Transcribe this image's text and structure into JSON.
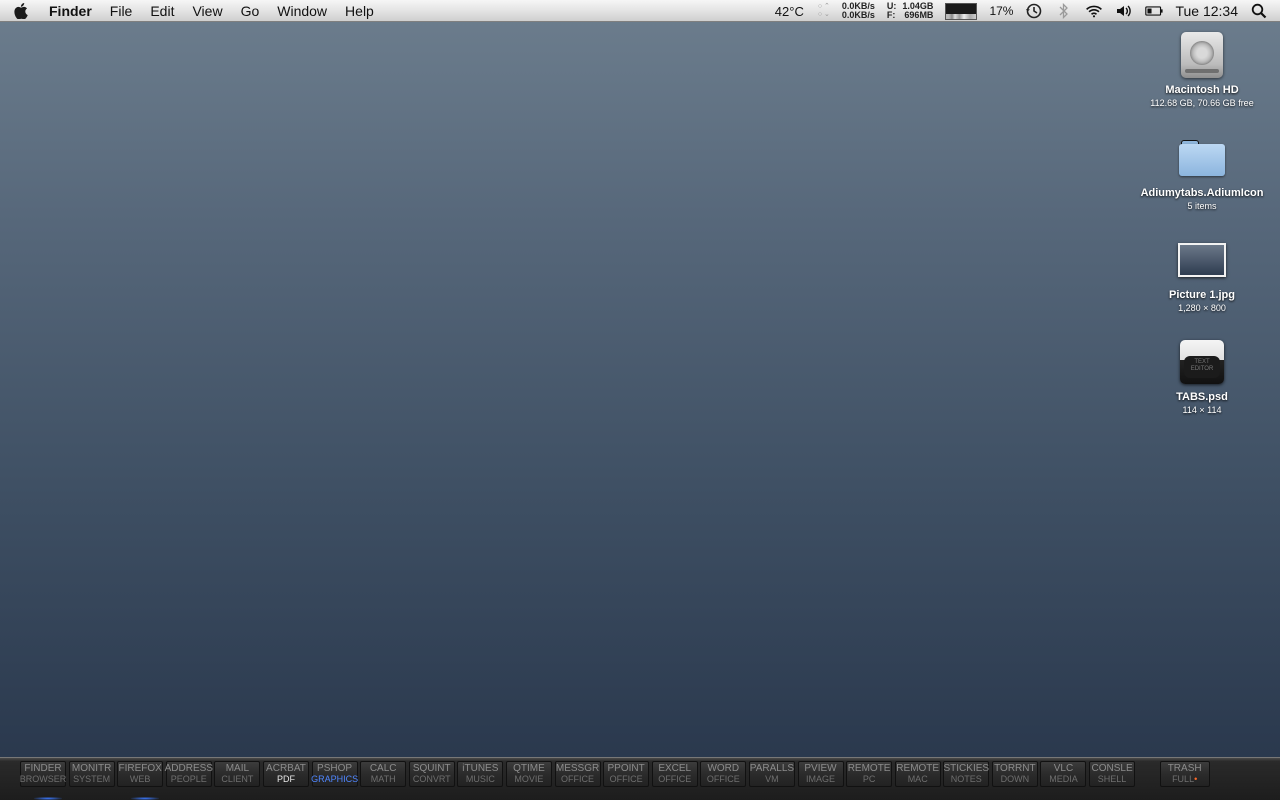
{
  "menubar": {
    "app_name": "Finder",
    "menus": [
      "File",
      "Edit",
      "View",
      "Go",
      "Window",
      "Help"
    ],
    "status": {
      "temperature": "42°C",
      "net_down": "0.0KB/s",
      "net_up": "0.0KB/s",
      "mem_used_label": "U:",
      "mem_free_label": "F:",
      "mem_used": "1.04GB",
      "mem_free": "696MB",
      "cpu_percent": "17%",
      "clock": "Tue 12:34"
    }
  },
  "desktop_icons": [
    {
      "name": "Macintosh HD",
      "info": "112.68 GB, 70.66 GB free",
      "icon": "hard-drive-icon"
    },
    {
      "name": "Adiumytabs.AdiumIcon",
      "info": "5 items",
      "icon": "folder-icon"
    },
    {
      "name": "Picture 1.jpg",
      "info": "1,280 × 800",
      "icon": "image-file-icon"
    },
    {
      "name": "TABS.psd",
      "info": "114 × 114",
      "icon": "psd-file-icon",
      "thumb_text": "TEXT EDITOR"
    }
  ],
  "dock": {
    "tabs": [
      {
        "top": "FINDER",
        "sub": "BROWSER"
      },
      {
        "top": "MONITR",
        "sub": "SYSTEM"
      },
      {
        "top": "FIREFOX",
        "sub": "WEB"
      },
      {
        "top": "ADDRESS",
        "sub": "PEOPLE"
      },
      {
        "top": "MAIL",
        "sub": "CLIENT"
      },
      {
        "top": "ACRBAT",
        "sub": "PDF"
      },
      {
        "top": "PSHOP",
        "sub": "GRAPHICS"
      },
      {
        "top": "CALC",
        "sub": "MATH"
      },
      {
        "top": "SQUINT",
        "sub": "CONVRT"
      },
      {
        "top": "iTUNES",
        "sub": "MUSIC"
      },
      {
        "top": "QTIME",
        "sub": "MOVIE"
      },
      {
        "top": "MESSGR",
        "sub": "OFFICE"
      },
      {
        "top": "PPOINT",
        "sub": "OFFICE"
      },
      {
        "top": "EXCEL",
        "sub": "OFFICE"
      },
      {
        "top": "WORD",
        "sub": "OFFICE"
      },
      {
        "top": "PARALLS",
        "sub": "VM"
      },
      {
        "top": "PVIEW",
        "sub": "IMAGE"
      },
      {
        "top": "REMOTE",
        "sub": "PC"
      },
      {
        "top": "REMOTE",
        "sub": "MAC"
      },
      {
        "top": "STICKIES",
        "sub": "NOTES"
      },
      {
        "top": "TORRNT",
        "sub": "DOWN"
      },
      {
        "top": "VLC",
        "sub": "MEDIA"
      },
      {
        "top": "CONSLE",
        "sub": "SHELL"
      }
    ],
    "trash": {
      "top": "TRASH",
      "sub": "FULL",
      "dot": "•"
    }
  }
}
